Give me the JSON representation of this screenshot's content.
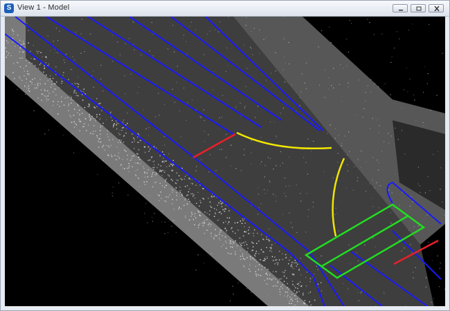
{
  "window": {
    "title": "View 1 - Model",
    "app_icon_glyph": "S"
  },
  "controls": {
    "minimize": "minimize-icon",
    "restore": "restore-icon",
    "close": "close-icon"
  },
  "viewport": {
    "content": "point-cloud-road-scene",
    "colors": {
      "background": "#000000",
      "points": "#d8d8d8",
      "lane_lines": "#1a1aff",
      "curb_curves": "#f2e600",
      "crosswalk": "#22dd22",
      "stop_lines": "#e8202a"
    }
  }
}
